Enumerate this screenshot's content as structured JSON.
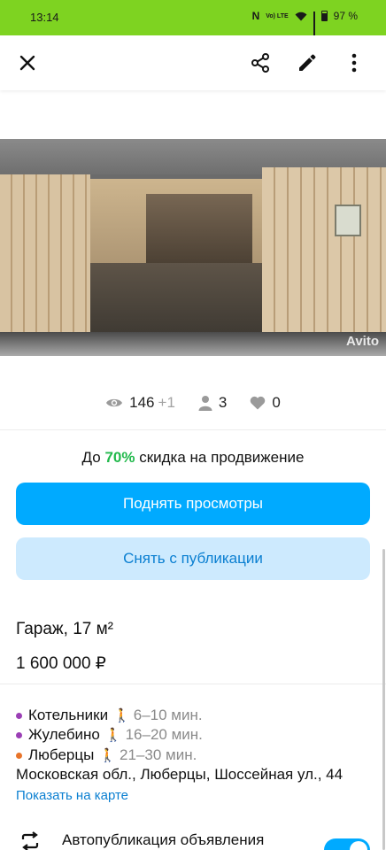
{
  "status_bar": {
    "time": "13:14",
    "nfc": "N",
    "volte": "Vo) LTE",
    "battery": "97 %"
  },
  "toolbar": {
    "close_icon": "close-icon",
    "share_icon": "share-icon",
    "edit_icon": "edit-icon",
    "more_icon": "more-vertical-icon"
  },
  "photo": {
    "watermark": "Avito"
  },
  "stats": {
    "views": "146",
    "views_today": "+1",
    "contacts": "3",
    "favorites": "0"
  },
  "promo": {
    "prefix": "До",
    "percent": "70%",
    "suffix": "скидка на продвижение"
  },
  "buttons": {
    "raise_views": "Поднять просмотры",
    "unpublish": "Снять с публикации"
  },
  "listing": {
    "title": "Гараж, 17 м²",
    "price": "1 600 000 ₽"
  },
  "metro": [
    {
      "name": "Котельники",
      "time": "6–10 мин.",
      "color": "#9b3fb5"
    },
    {
      "name": "Жулебино",
      "time": "16–20 мин.",
      "color": "#9b3fb5"
    },
    {
      "name": "Люберцы",
      "time": "21–30 мин.",
      "color": "#e8742a"
    }
  ],
  "address": "Московская обл., Люберцы, Шоссейная ул., 44",
  "map_link": "Показать на карте",
  "autopublish": {
    "label": "Автопубликация объявления",
    "enabled": true
  },
  "colors": {
    "status_bar": "#7ed321",
    "primary": "#00aaff",
    "secondary_bg": "#cdeafe",
    "link": "#0a7fd1",
    "discount": "#22b94c"
  }
}
